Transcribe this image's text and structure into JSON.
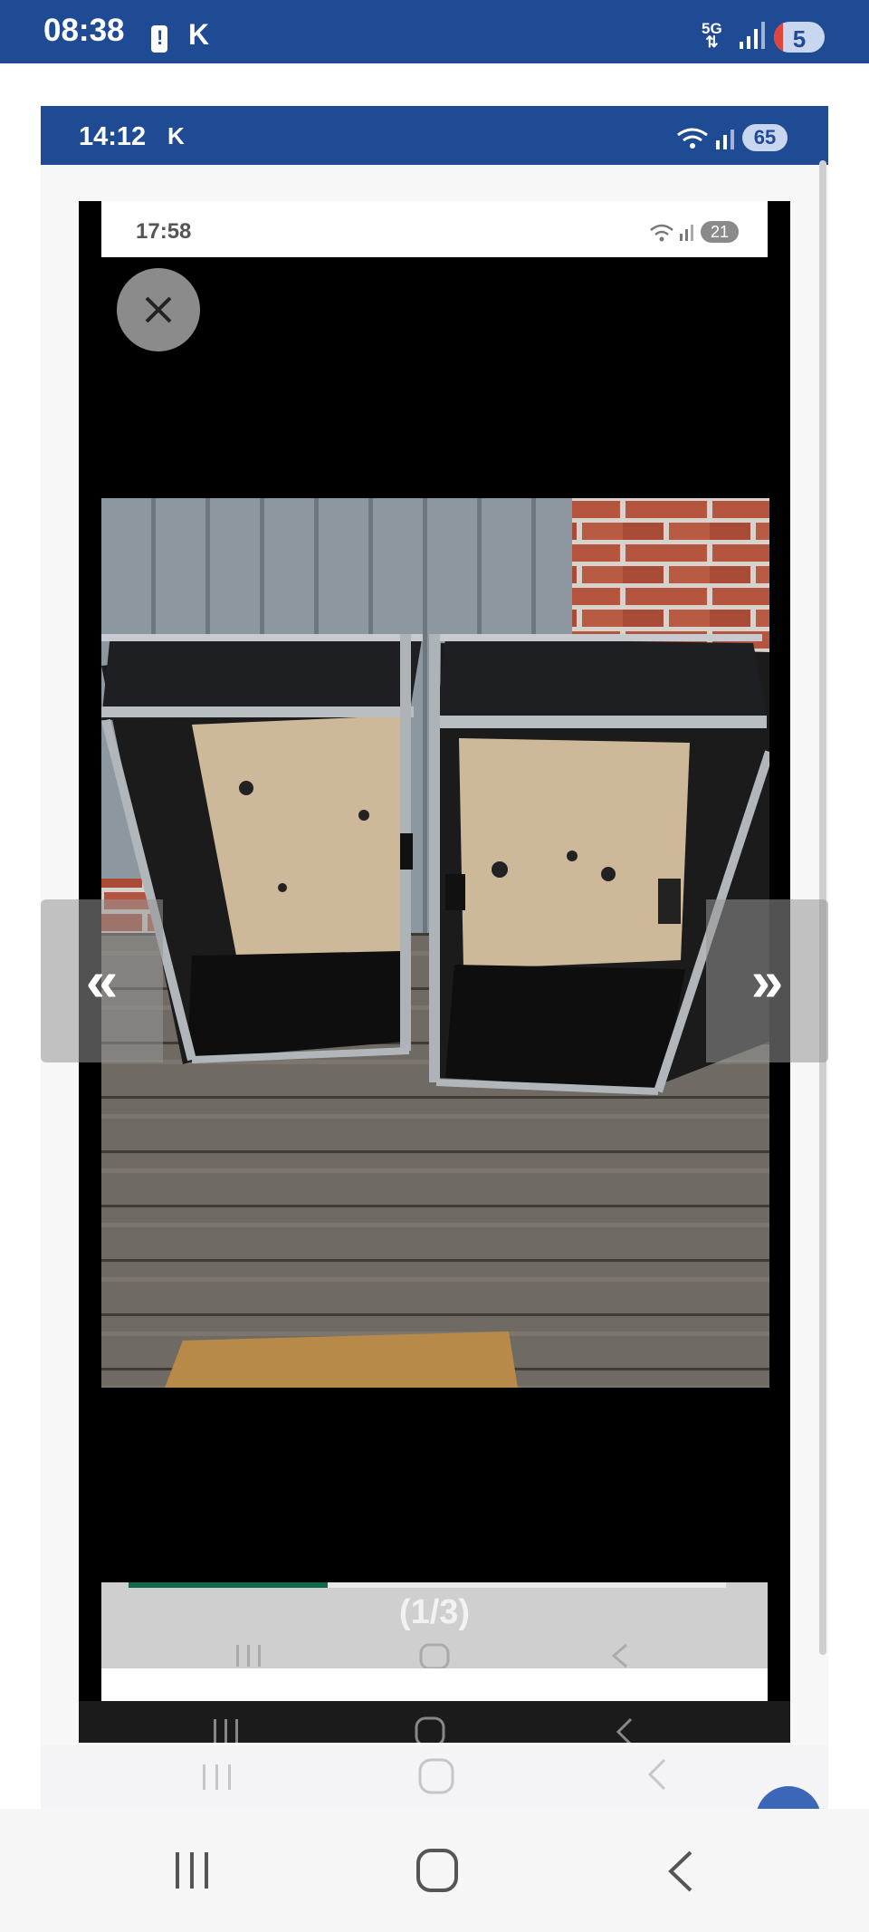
{
  "status_bar": {
    "time": "08:38",
    "carrier_icon": "K",
    "network": "5G",
    "battery": "5"
  },
  "inner_screenshot_1": {
    "time": "14:12",
    "carrier_icon": "K",
    "battery": "65"
  },
  "inner_screenshot_2": {
    "time": "17:58",
    "battery": "21"
  },
  "viewer": {
    "close_icon": "close-icon",
    "prev_label": "«",
    "next_label": "»",
    "counter": "(1/3)",
    "photo_description_icon": "photo"
  },
  "nav": {
    "recents_icon": "recents-icon",
    "home_icon": "home-icon",
    "back_icon": "back-icon"
  },
  "colors": {
    "status_blue": "#1f4a94",
    "progress_green": "#0f6b49"
  }
}
